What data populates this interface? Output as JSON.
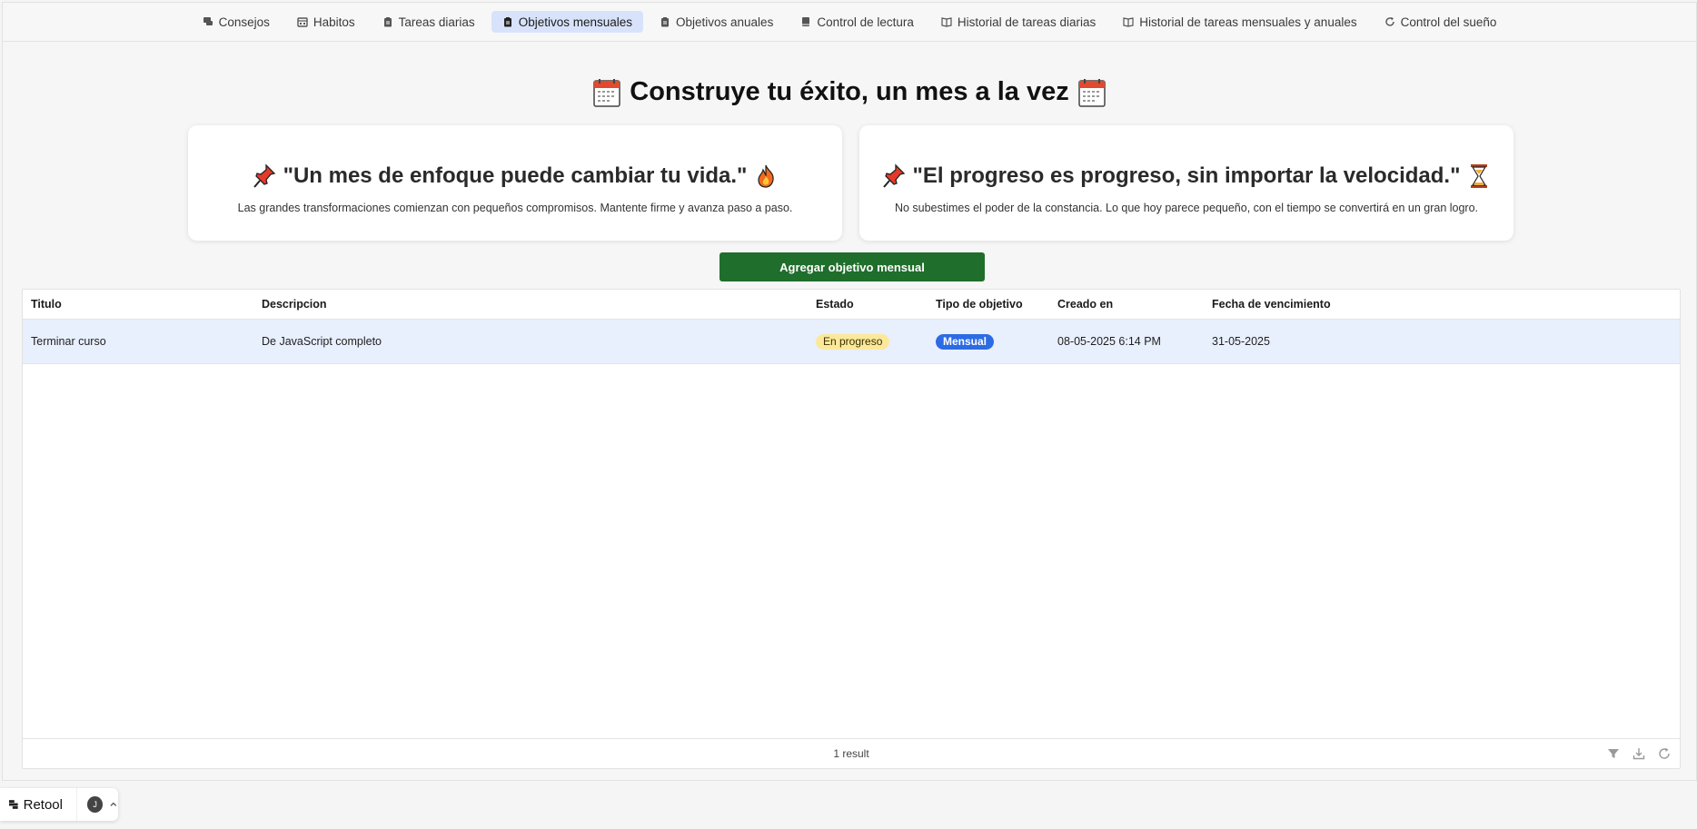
{
  "nav": {
    "tabs": [
      {
        "label": "Consejos",
        "icon": "chat-tip-icon",
        "active": false
      },
      {
        "label": "Habitos",
        "icon": "calendar-grid-icon",
        "active": false
      },
      {
        "label": "Tareas diarias",
        "icon": "clipboard-icon",
        "active": false
      },
      {
        "label": "Objetivos mensuales",
        "icon": "clipboard-icon",
        "active": true
      },
      {
        "label": "Objetivos anuales",
        "icon": "clipboard-icon",
        "active": false
      },
      {
        "label": "Control de lectura",
        "icon": "book-icon",
        "active": false
      },
      {
        "label": "Historial de tareas diarias",
        "icon": "open-book-icon",
        "active": false
      },
      {
        "label": "Historial de tareas mensuales y anuales",
        "icon": "open-book-icon",
        "active": false
      },
      {
        "label": "Control del sueño",
        "icon": "refresh-icon",
        "active": false
      }
    ]
  },
  "header": {
    "title": "Construye tu éxito, un mes a la vez"
  },
  "cards": [
    {
      "quote": "\"Un mes de enfoque puede cambiar tu vida.\"",
      "text": "Las grandes transformaciones comienzan con pequeños compromisos. Mantente firme y avanza paso a paso.",
      "lead_icon": "pushpin-icon",
      "trail_icon": "fire-icon"
    },
    {
      "quote": "\"El progreso es progreso, sin importar la velocidad.\"",
      "text": "No subestimes el poder de la constancia. Lo que hoy parece pequeño, con el tiempo se convertirá en un gran logro.",
      "lead_icon": "pushpin-icon",
      "trail_icon": "hourglass-icon"
    }
  ],
  "actions": {
    "add_label": "Agregar objetivo mensual"
  },
  "table": {
    "columns": [
      "Titulo",
      "Descripcion",
      "Estado",
      "Tipo de objetivo",
      "Creado en",
      "Fecha de vencimiento"
    ],
    "rows": [
      {
        "titulo": "Terminar curso",
        "descripcion": "De JavaScript completo",
        "estado": "En progreso",
        "tipo": "Mensual",
        "creado": "08-05-2025 6:14 PM",
        "vencimiento": "31-05-2025"
      }
    ],
    "footer": "1 result"
  },
  "retool": {
    "name": "Retool",
    "avatar": "J"
  },
  "colors": {
    "accent_green": "#1f6e2b",
    "active_tab": "#d8e3fb",
    "badge_yellow": "#fbe89a",
    "badge_blue": "#2c6be3",
    "selected_row": "#e8effd"
  }
}
